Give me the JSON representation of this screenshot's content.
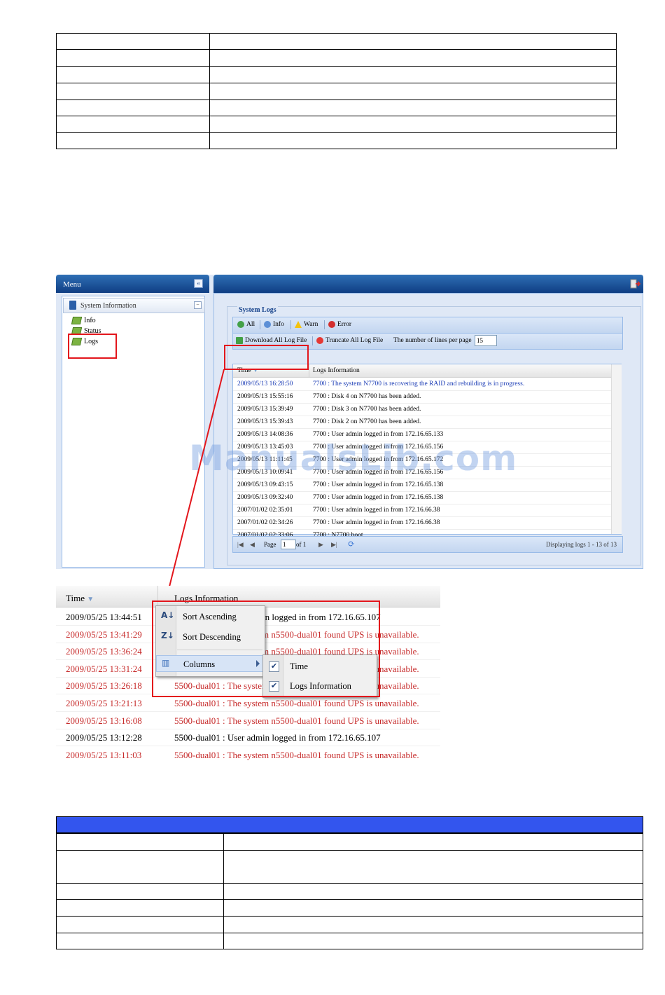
{
  "menu_panel": {
    "title": "Menu"
  },
  "tree": {
    "header": "System Information",
    "items": [
      "Info",
      "Status",
      "Logs"
    ]
  },
  "system_logs": {
    "title": "System Logs",
    "filters": {
      "all": "All",
      "info": "Info",
      "warn": "Warn",
      "error": "Error"
    },
    "actions": {
      "download": "Download All Log File",
      "truncate": "Truncate All Log File",
      "lines_label": "The number of lines per page",
      "lines_value": "15"
    },
    "columns": {
      "time": "Time",
      "info": "Logs Information"
    },
    "rows": [
      {
        "time": "2009/05/13 16:28:50",
        "msg": "7700 : The system N7700 is recovering the RAID and rebuilding is in progress."
      },
      {
        "time": "2009/05/13 15:55:16",
        "msg": "7700 : Disk 4 on N7700 has been added."
      },
      {
        "time": "2009/05/13 15:39:49",
        "msg": "7700 : Disk 3 on N7700 has been added."
      },
      {
        "time": "2009/05/13 15:39:43",
        "msg": "7700 : Disk 2 on N7700 has been added."
      },
      {
        "time": "2009/05/13 14:08:36",
        "msg": "7700 : User admin logged in from 172.16.65.133"
      },
      {
        "time": "2009/05/13 13:45:03",
        "msg": "7700 : User admin logged in from 172.16.65.156"
      },
      {
        "time": "2009/05/13 11:11:45",
        "msg": "7700 : User admin logged in from 172.16.65.172"
      },
      {
        "time": "2009/05/13 10:09:41",
        "msg": "7700 : User admin logged in from 172.16.65.156"
      },
      {
        "time": "2009/05/13 09:43:15",
        "msg": "7700 : User admin logged in from 172.16.65.138"
      },
      {
        "time": "2009/05/13 09:32:40",
        "msg": "7700 : User admin logged in from 172.16.65.138"
      },
      {
        "time": "2007/01/02 02:35:01",
        "msg": "7700 : User admin logged in from 172.16.66.38"
      },
      {
        "time": "2007/01/02 02:34:26",
        "msg": "7700 : User admin logged in from 172.16.66.38"
      },
      {
        "time": "2007/01/02 02:33:06",
        "msg": "7700 : N7700 boot"
      }
    ],
    "pager": {
      "page_label": "Page",
      "page_value": "1",
      "of_label": "of 1",
      "display": "Displaying logs 1 - 13 of 13"
    }
  },
  "zoom_grid": {
    "columns": {
      "time": "Time",
      "info": "Logs Information"
    },
    "rows": [
      {
        "time": "2009/05/25 13:44:51",
        "msg": "5500-dual01 : User admin logged in from 172.16.65.107",
        "type": "info"
      },
      {
        "time": "2009/05/25 13:41:29",
        "msg": "5500-dual01 : The system n5500-dual01 found UPS is unavailable.",
        "type": "error"
      },
      {
        "time": "2009/05/25 13:36:24",
        "msg": "5500-dual01 : The system n5500-dual01 found UPS is unavailable.",
        "type": "error"
      },
      {
        "time": "2009/05/25 13:31:24",
        "msg": "5500-dual01 : The system n5500-dual01 found UPS is unavailable.",
        "type": "error"
      },
      {
        "time": "2009/05/25 13:26:18",
        "msg": "5500-dual01 : The system n5500-dual01 found UPS is unavailable.",
        "type": "error"
      },
      {
        "time": "2009/05/25 13:21:13",
        "msg": "5500-dual01 : The system n5500-dual01 found UPS is unavailable.",
        "type": "error"
      },
      {
        "time": "2009/05/25 13:16:08",
        "msg": "5500-dual01 : The system n5500-dual01 found UPS is unavailable.",
        "type": "error"
      },
      {
        "time": "2009/05/25 13:12:28",
        "msg": "5500-dual01 : User admin logged in from 172.16.65.107",
        "type": "info"
      },
      {
        "time": "2009/05/25 13:11:03",
        "msg": "5500-dual01 : The system n5500-dual01 found UPS is unavailable.",
        "type": "error"
      }
    ]
  },
  "context_menu": {
    "sort_asc": "Sort Ascending",
    "sort_desc": "Sort Descending",
    "columns": "Columns",
    "submenu": [
      "Time",
      "Logs Information"
    ]
  },
  "watermark": "ManualsLib.com",
  "colors": {
    "accent_red": "#e3161c",
    "header_blue": "#3355ee",
    "error_text": "#c62828",
    "link_blue": "#1a3bb5"
  }
}
